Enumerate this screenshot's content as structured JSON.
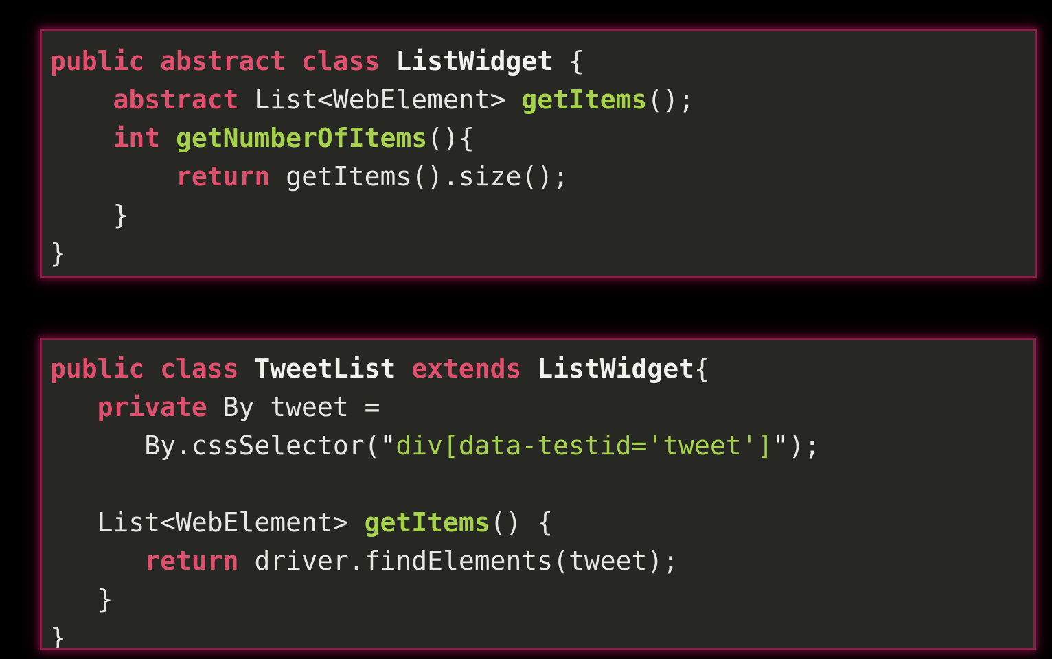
{
  "slide": {
    "background_color": "#000000",
    "block_background": "#272824",
    "block_border_color": "#8e1a47",
    "colors": {
      "keyword": "#e0506e",
      "type": "#f2f2ec",
      "function": "#a6d24b",
      "plain": "#e8e8e2",
      "string": "#a6d24b",
      "quote": "#f2f2ec"
    }
  },
  "code_blocks": [
    {
      "id": "block-1",
      "language": "java",
      "plain_text": "public abstract class ListWidget {\n    abstract List<WebElement> getItems();\n    int getNumberOfItems(){\n        return getItems().size();\n    }\n}",
      "lines": [
        {
          "indent": "",
          "tokens": [
            {
              "text": "public abstract class ",
              "kind": "kw"
            },
            {
              "text": "ListWidget",
              "kind": "type"
            },
            {
              "text": " {",
              "kind": "plain"
            }
          ]
        },
        {
          "indent": "    ",
          "tokens": [
            {
              "text": "abstract ",
              "kind": "kw"
            },
            {
              "text": "List<WebElement> ",
              "kind": "plain"
            },
            {
              "text": "getItems",
              "kind": "fn"
            },
            {
              "text": "();",
              "kind": "plain"
            }
          ]
        },
        {
          "indent": "    ",
          "tokens": [
            {
              "text": "int ",
              "kind": "kw"
            },
            {
              "text": "getNumberOfItems",
              "kind": "fn"
            },
            {
              "text": "(){",
              "kind": "plain"
            }
          ]
        },
        {
          "indent": "        ",
          "tokens": [
            {
              "text": "return ",
              "kind": "kw"
            },
            {
              "text": "getItems().size();",
              "kind": "plain"
            }
          ]
        },
        {
          "indent": "    ",
          "tokens": [
            {
              "text": "}",
              "kind": "plain"
            }
          ]
        },
        {
          "indent": "",
          "tokens": [
            {
              "text": "}",
              "kind": "plain"
            }
          ]
        }
      ]
    },
    {
      "id": "block-2",
      "language": "java",
      "plain_text": "public class TweetList extends ListWidget{\n    private By tweet =\n        By.cssSelector(\"div[data-testid='tweet']\");\n\n    List<WebElement> getItems() {\n        return driver.findElements(tweet);\n    }\n}",
      "lines": [
        {
          "indent": "",
          "tokens": [
            {
              "text": "public class ",
              "kind": "kw"
            },
            {
              "text": "TweetList",
              "kind": "type"
            },
            {
              "text": " extends ",
              "kind": "kw"
            },
            {
              "text": "ListWidget",
              "kind": "type"
            },
            {
              "text": "{",
              "kind": "plain"
            }
          ]
        },
        {
          "indent": "   ",
          "tokens": [
            {
              "text": "private ",
              "kind": "kw"
            },
            {
              "text": "By tweet =",
              "kind": "plain"
            }
          ]
        },
        {
          "indent": "      ",
          "tokens": [
            {
              "text": "By.cssSelector(",
              "kind": "plain"
            },
            {
              "text": "\"",
              "kind": "quote"
            },
            {
              "text": "div[data-testid='tweet']",
              "kind": "str"
            },
            {
              "text": "\"",
              "kind": "quote"
            },
            {
              "text": ");",
              "kind": "plain"
            }
          ]
        },
        {
          "indent": "",
          "tokens": []
        },
        {
          "indent": "   ",
          "tokens": [
            {
              "text": "List<WebElement> ",
              "kind": "plain"
            },
            {
              "text": "getItems",
              "kind": "fn"
            },
            {
              "text": "() {",
              "kind": "plain"
            }
          ]
        },
        {
          "indent": "      ",
          "tokens": [
            {
              "text": "return ",
              "kind": "kw"
            },
            {
              "text": "driver.findElements(tweet);",
              "kind": "plain"
            }
          ]
        },
        {
          "indent": "   ",
          "tokens": [
            {
              "text": "}",
              "kind": "plain"
            }
          ]
        },
        {
          "indent": "",
          "tokens": [
            {
              "text": "}",
              "kind": "plain"
            }
          ]
        }
      ]
    }
  ]
}
